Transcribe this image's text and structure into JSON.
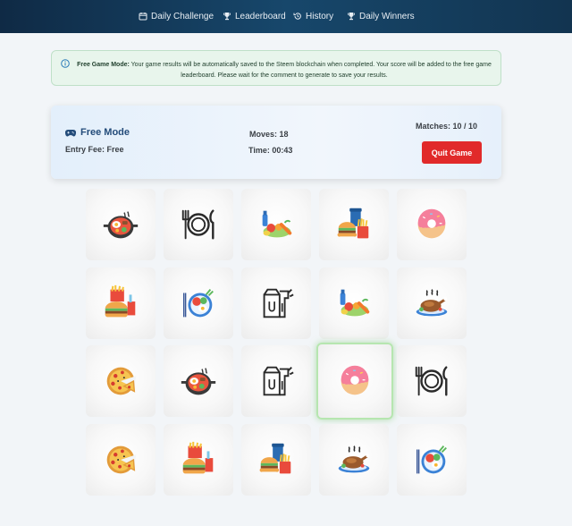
{
  "nav": [
    {
      "label": "Daily Challenge",
      "icon": "calendar-icon"
    },
    {
      "label": "Leaderboard",
      "icon": "trophy-icon"
    },
    {
      "label": "History",
      "icon": "history-icon"
    },
    {
      "label": "Daily Winners",
      "icon": "trophy-icon"
    }
  ],
  "info": {
    "icon": "info-icon",
    "title": "Free Game Mode:",
    "message": "Your game results will be automatically saved to the Steem blockchain when completed. Your score will be added to the free game leaderboard. Please wait for the comment to generate to save your results."
  },
  "status": {
    "mode_label": "Free Mode",
    "mode_icon": "gamepad-icon",
    "entry_fee": "Entry Fee: Free",
    "moves": "Moves: 18",
    "time": "Time: 00:43",
    "matches": "Matches: 10 / 10",
    "quit_label": "Quit Game"
  },
  "colors": {
    "nav_bg": "#17476b",
    "quit_button": "#e12a2a",
    "mode_text": "#244c7a",
    "info_bg": "#e8f5ec",
    "selected_card_border": "#b6e6b0"
  },
  "cards": [
    {
      "icon": "wok-pan-icon",
      "selected": false
    },
    {
      "icon": "plate-fork-knife-icon",
      "selected": false
    },
    {
      "icon": "groceries-icon",
      "selected": false
    },
    {
      "icon": "fast-food-combo-icon",
      "selected": false
    },
    {
      "icon": "donut-icon",
      "selected": false
    },
    {
      "icon": "burger-fries-icon",
      "selected": false
    },
    {
      "icon": "salad-plate-icon",
      "selected": false
    },
    {
      "icon": "takeout-bag-icon",
      "selected": false
    },
    {
      "icon": "groceries-icon",
      "selected": false
    },
    {
      "icon": "roast-chicken-icon",
      "selected": false
    },
    {
      "icon": "pizza-icon",
      "selected": false
    },
    {
      "icon": "wok-pan-icon",
      "selected": false
    },
    {
      "icon": "takeout-bag-icon",
      "selected": false
    },
    {
      "icon": "donut-icon",
      "selected": true
    },
    {
      "icon": "plate-fork-knife-icon",
      "selected": false
    },
    {
      "icon": "pizza-icon",
      "selected": false
    },
    {
      "icon": "burger-fries-icon",
      "selected": false
    },
    {
      "icon": "fast-food-combo-icon",
      "selected": false
    },
    {
      "icon": "roast-chicken-icon",
      "selected": false
    },
    {
      "icon": "salad-plate-icon",
      "selected": false
    }
  ]
}
